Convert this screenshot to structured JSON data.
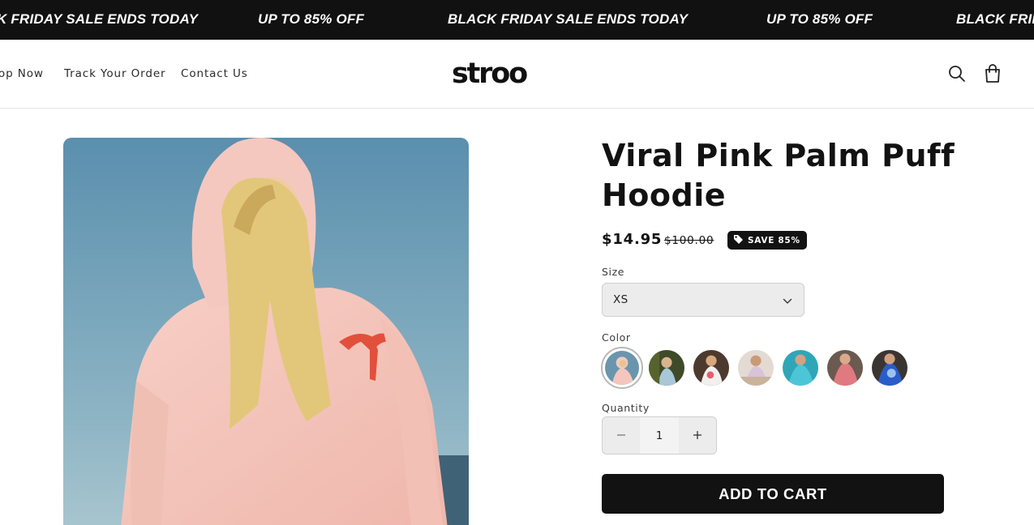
{
  "announcement": {
    "messages": [
      "BLACK FRIDAY SALE ENDS TODAY",
      "UP TO 85% OFF",
      "BLACK FRIDAY SALE ENDS TODAY",
      "UP TO 85% OFF",
      "BLACK FRIDAY SALE ENDS TODAY"
    ]
  },
  "header": {
    "nav": [
      "Shop Now",
      "Track Your Order",
      "Contact Us"
    ],
    "logo": "stroo",
    "icons": [
      "search-icon",
      "cart-icon"
    ]
  },
  "product": {
    "title": "Viral Pink Palm Puff Hoodie",
    "price": "$14.95",
    "compare_price": "$100.00",
    "badge": "SAVE 85%",
    "size_label": "Size",
    "size_value": "XS",
    "color_label": "Color",
    "color_count": 7,
    "selected_color_index": 0,
    "quantity_label": "Quantity",
    "quantity_value": "1",
    "add_to_cart_label": "ADD TO CART"
  },
  "colors": {
    "background": "#ffffff",
    "announcement_bg": "#111111",
    "button_bg": "#121212",
    "select_bg": "#ececec"
  }
}
